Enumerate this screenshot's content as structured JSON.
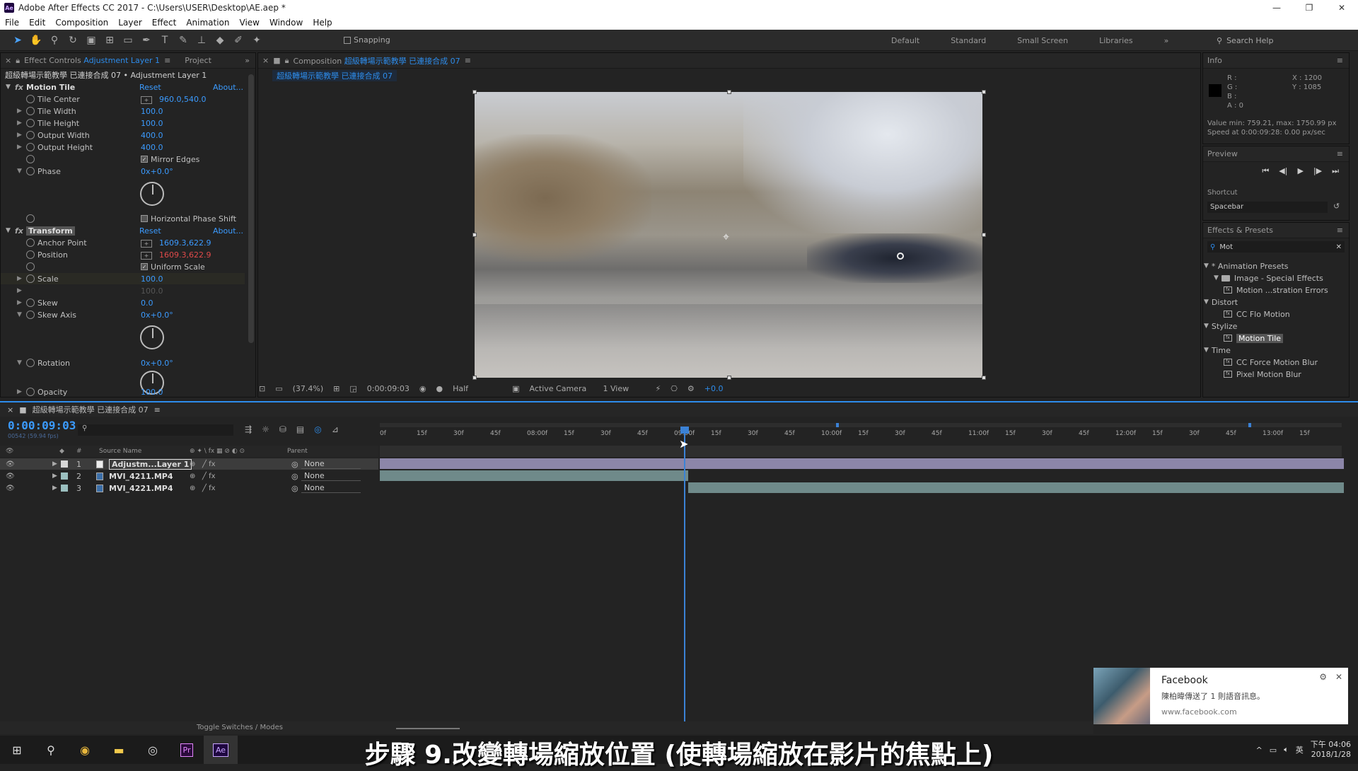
{
  "window": {
    "title": "Adobe After Effects CC 2017 - C:\\Users\\USER\\Desktop\\AE.aep *"
  },
  "menu": [
    "File",
    "Edit",
    "Composition",
    "Layer",
    "Effect",
    "Animation",
    "View",
    "Window",
    "Help"
  ],
  "toolbar": {
    "snapping": "Snapping",
    "workspaces": [
      "Default",
      "Standard",
      "Small Screen",
      "Libraries"
    ],
    "search_help": "Search Help"
  },
  "effect_controls": {
    "tab_label": "Effect Controls",
    "tab_layer": "Adjustment Layer 1",
    "project_tab": "Project",
    "subtitle": "超級轉場示範教學 已連接合成 07 • Adjustment Layer 1",
    "motion_tile": {
      "name": "Motion Tile",
      "reset": "Reset",
      "about": "About...",
      "tile_center_label": "Tile Center",
      "tile_center": "960.0,540.0",
      "tile_width_label": "Tile Width",
      "tile_width": "100.0",
      "tile_height_label": "Tile Height",
      "tile_height": "100.0",
      "output_width_label": "Output Width",
      "output_width": "400.0",
      "output_height_label": "Output Height",
      "output_height": "400.0",
      "mirror_edges": "Mirror Edges",
      "phase_label": "Phase",
      "phase": "0x+0.0°",
      "horizontal_phase_shift": "Horizontal Phase Shift"
    },
    "transform": {
      "name": "Transform",
      "reset": "Reset",
      "about": "About...",
      "anchor_label": "Anchor Point",
      "anchor": "1609.3,622.9",
      "position_label": "Position",
      "position": "1609.3,622.9",
      "uniform_scale": "Uniform Scale",
      "scale_label": "Scale",
      "scale": "100.0",
      "scale2": "100.0",
      "skew_label": "Skew",
      "skew": "0.0",
      "skew_axis_label": "Skew Axis",
      "skew_axis": "0x+0.0°",
      "rotation_label": "Rotation",
      "rotation": "0x+0.0°",
      "opacity_label": "Opacity",
      "opacity": "100.0"
    }
  },
  "composition": {
    "tab_label": "Composition",
    "comp_name": "超級轉場示範教學 已連接合成 07",
    "breadcrumb": "超級轉場示範教學 已連接合成 07",
    "zoom": "(37.4%)",
    "time": "0:00:09:03",
    "resolution": "Half",
    "camera": "Active Camera",
    "views": "1 View",
    "exposure": "+0.0"
  },
  "info": {
    "title": "Info",
    "r": "R :",
    "g": "G :",
    "b": "B :",
    "a": "A : 0",
    "x": "X : 1200",
    "y": "Y : 1085",
    "value_line": "Value min: 759.21, max: 1750.99 px",
    "speed_line": "Speed at 0:00:09:28: 0.00 px/sec"
  },
  "preview": {
    "title": "Preview",
    "shortcut_label": "Shortcut",
    "shortcut": "Spacebar"
  },
  "effects_presets": {
    "title": "Effects & Presets",
    "search": "Mot",
    "items": [
      {
        "label": "* Animation Presets",
        "indent": 0,
        "kind": "group"
      },
      {
        "label": "Image - Special Effects",
        "indent": 1,
        "kind": "folder"
      },
      {
        "label": "Motion ...stration Errors",
        "indent": 2,
        "kind": "preset"
      },
      {
        "label": "Distort",
        "indent": 0,
        "kind": "group"
      },
      {
        "label": "CC Flo Motion",
        "indent": 2,
        "kind": "preset"
      },
      {
        "label": "Stylize",
        "indent": 0,
        "kind": "group"
      },
      {
        "label": "Motion Tile",
        "indent": 2,
        "kind": "preset-selected"
      },
      {
        "label": "Time",
        "indent": 0,
        "kind": "group"
      },
      {
        "label": "CC Force Motion Blur",
        "indent": 2,
        "kind": "preset"
      },
      {
        "label": "Pixel Motion Blur",
        "indent": 2,
        "kind": "preset"
      }
    ]
  },
  "timeline": {
    "comp_name": "超級轉場示範教學 已連接合成 07",
    "timecode": "0:00:09:03",
    "fps": "00542 (59.94 fps)",
    "columns": {
      "source": "Source Name",
      "parent": "Parent"
    },
    "toggle": "Toggle Switches / Modes",
    "ruler": [
      "0f",
      "15f",
      "30f",
      "45f",
      "08:00f",
      "15f",
      "30f",
      "45f",
      "09:00f",
      "15f",
      "30f",
      "45f",
      "10:00f",
      "15f",
      "30f",
      "45f",
      "11:00f",
      "15f",
      "30f",
      "45f",
      "12:00f",
      "15f",
      "30f",
      "45f",
      "13:00f",
      "15f"
    ],
    "layers": [
      {
        "num": "1",
        "name": "Adjustm...Layer 1",
        "parent": "None",
        "label_color": "#d8d8d8",
        "bar_color": "#8c86a9"
      },
      {
        "num": "2",
        "name": "MVI_4211.MP4",
        "parent": "None",
        "label_color": "#9bbfbf",
        "bar_color": "#6f8a8a"
      },
      {
        "num": "3",
        "name": "MVI_4221.MP4",
        "parent": "None",
        "label_color": "#9bbfbf",
        "bar_color": "#6f8a8a"
      }
    ]
  },
  "notification": {
    "app": "Facebook",
    "message": "陳柏暐傳送了 1 則語音訊息。",
    "url": "www.facebook.com"
  },
  "subtitle_text": "步驟 9.改變轉場縮放位置 (使轉場縮放在影片的焦點上)",
  "clock": {
    "time": "下午 04:06",
    "date": "2018/1/28"
  },
  "colors": {
    "accent": "#2d8ceb",
    "panel": "#232323"
  }
}
